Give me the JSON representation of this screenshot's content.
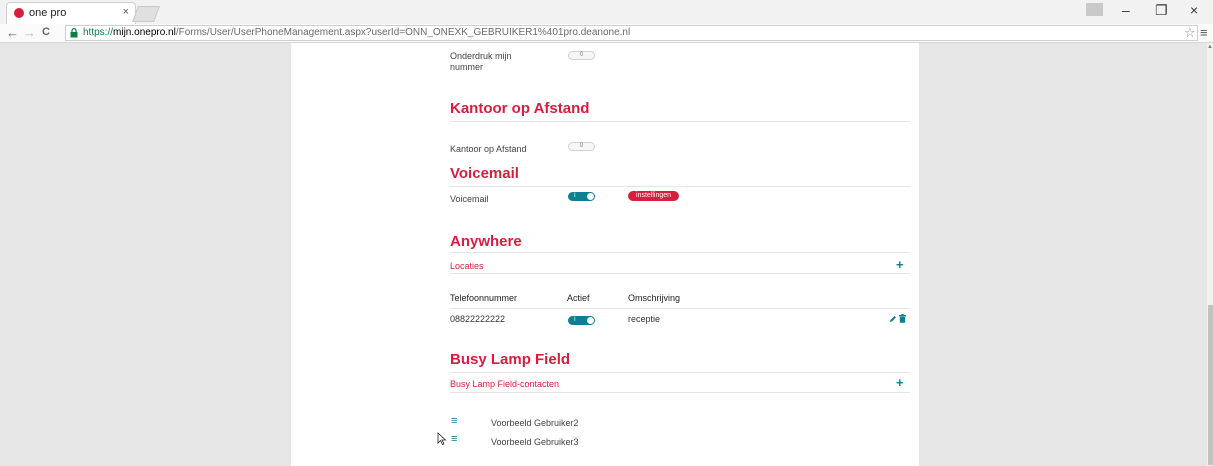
{
  "browser": {
    "tab_title": "one pro",
    "tab_close": "×",
    "caption": {
      "minimize": "–",
      "maximize": "❐",
      "close": "×"
    },
    "url": {
      "secure": "https://",
      "host": "mijn.onepro.nl",
      "path": "/Forms/User/UserPhoneManagement.aspx?userId=ONN_ONEXK_GEBRUIKER1%401pro.deanone.nl"
    },
    "nav": {
      "back": "←",
      "forward": "→",
      "reload": "C"
    },
    "star": "☆",
    "menu": "≡"
  },
  "colors": {
    "accent_red": "#d61f3c",
    "accent_teal": "#0e7f90"
  },
  "settings": {
    "onderdruk_label": "Onderdruk mijn nummer",
    "onderdruk_toggle": "0",
    "kantoor_title": "Kantoor op Afstand",
    "kantoor_label": "Kantoor op Afstand",
    "kantoor_toggle": "0",
    "voicemail_title": "Voicemail",
    "voicemail_label": "Voicemail",
    "voicemail_toggle": "I",
    "voicemail_button": "instellingen"
  },
  "anywhere": {
    "title": "Anywhere",
    "subbar": "Locaties",
    "columns": [
      "Telefoonnummer",
      "Actief",
      "Omschrijving"
    ],
    "rows": [
      {
        "telefoonnummer": "08822222222",
        "actief": "I",
        "omschrijving": "receptie"
      }
    ]
  },
  "blf": {
    "title": "Busy Lamp Field",
    "subbar": "Busy Lamp Field-contacten",
    "contacts": [
      "Voorbeeld Gebruiker2",
      "Voorbeeld Gebruiker3"
    ]
  },
  "icons": [
    "lock-icon",
    "star-icon",
    "menu-icon",
    "plus-icon",
    "edit-icon",
    "trash-icon",
    "hamburger-icon",
    "cursor-icon"
  ]
}
